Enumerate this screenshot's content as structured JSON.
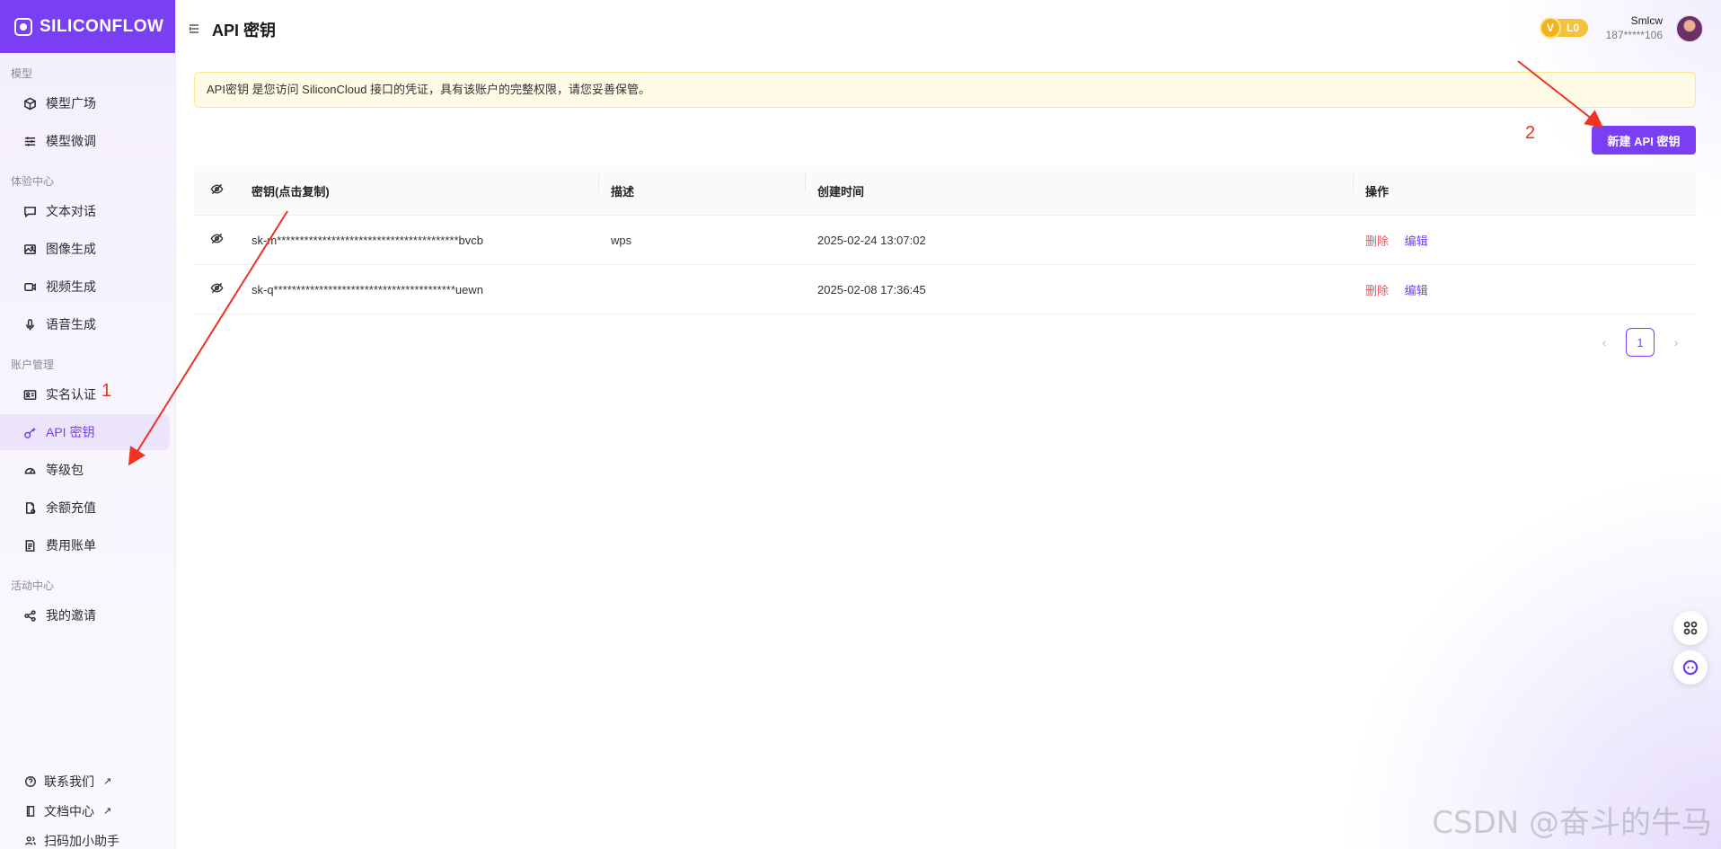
{
  "app": {
    "logo_text": "SILICONFLOW"
  },
  "sidebar": {
    "sections": [
      {
        "title": "模型",
        "items": [
          {
            "label": "模型广场",
            "icon": "cube-icon"
          },
          {
            "label": "模型微调",
            "icon": "sliders-icon"
          }
        ]
      },
      {
        "title": "体验中心",
        "items": [
          {
            "label": "文本对话",
            "icon": "chat-icon"
          },
          {
            "label": "图像生成",
            "icon": "image-icon"
          },
          {
            "label": "视频生成",
            "icon": "video-icon"
          },
          {
            "label": "语音生成",
            "icon": "mic-icon"
          }
        ]
      },
      {
        "title": "账户管理",
        "items": [
          {
            "label": "实名认证",
            "icon": "id-card-icon"
          },
          {
            "label": "API 密钥",
            "icon": "key-icon",
            "active": true
          },
          {
            "label": "等级包",
            "icon": "gauge-icon"
          },
          {
            "label": "余额充值",
            "icon": "wallet-icon"
          },
          {
            "label": "费用账单",
            "icon": "bill-icon"
          }
        ]
      },
      {
        "title": "活动中心",
        "items": [
          {
            "label": "我的邀请",
            "icon": "share-icon"
          }
        ]
      }
    ],
    "bottom_links": [
      {
        "label": "联系我们",
        "icon": "help-icon",
        "ext": "↗"
      },
      {
        "label": "文档中心",
        "icon": "book-icon",
        "ext": "↗"
      },
      {
        "label": "扫码加小助手",
        "icon": "people-icon"
      }
    ]
  },
  "header": {
    "title": "API 密钥",
    "level_badge": {
      "v": "V",
      "label": "L0"
    },
    "user": {
      "name": "Smlcw",
      "phone": "187*****106"
    }
  },
  "notice": "API密钥 是您访问 SiliconCloud 接口的凭证，具有该账户的完整权限，请您妥善保管。",
  "new_button": "新建 API 密钥",
  "table": {
    "headers": {
      "key": "密钥(点击复制)",
      "desc": "描述",
      "time": "创建时间",
      "op": "操作"
    },
    "rows": [
      {
        "key": "sk-m****************************************bvcb",
        "desc": "wps",
        "time": "2025-02-24 13:07:02",
        "del": "删除",
        "edit": "编辑"
      },
      {
        "key": "sk-q****************************************uewn",
        "desc": "",
        "time": "2025-02-08 17:36:45",
        "del": "删除",
        "edit": "编辑"
      }
    ]
  },
  "pagination": {
    "prev": "‹",
    "current": "1",
    "next": "›"
  },
  "annotations": {
    "one": "1",
    "two": "2"
  },
  "watermark": "CSDN @奋斗的牛马",
  "colors": {
    "brand": "#7a3ff2",
    "danger": "#ff4d4f",
    "notice_bg": "#fffbe6"
  }
}
